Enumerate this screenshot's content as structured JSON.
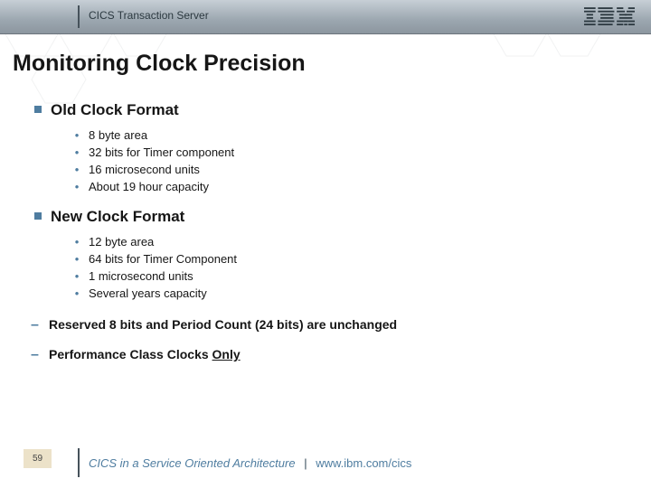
{
  "header": {
    "product": "CICS Transaction Server",
    "logo_name": "ibm-logo"
  },
  "title": "Monitoring Clock Precision",
  "sections": [
    {
      "heading": "Old Clock Format",
      "items": [
        "8 byte area",
        "32 bits for Timer component",
        "16 microsecond units",
        "About 19 hour capacity"
      ]
    },
    {
      "heading": "New Clock Format",
      "items": [
        "12 byte area",
        "64 bits for Timer Component",
        "1 microsecond units",
        "Several years capacity"
      ]
    }
  ],
  "notes": [
    {
      "text": "Reserved 8 bits and Period Count (24 bits) are unchanged",
      "underline_tail": false
    },
    {
      "text_prefix": "Performance Class Clocks ",
      "tail": "Only",
      "underline_tail": true
    }
  ],
  "footer": {
    "page": "59",
    "tagline": "CICS in a Service Oriented Architecture",
    "site": "www.ibm.com/cics"
  },
  "colors": {
    "accent": "#4f7da0",
    "header_rule": "#46525b"
  }
}
